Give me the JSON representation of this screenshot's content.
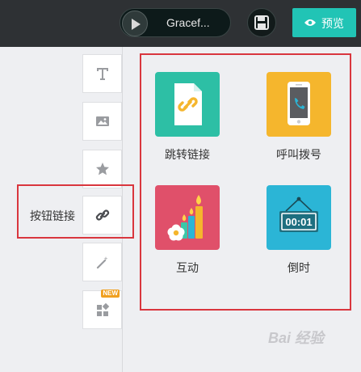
{
  "topbar": {
    "music_title": "Gracef...",
    "preview_label": "预览",
    "colors": {
      "bar": "#2e3134",
      "accent": "#21c4b5"
    }
  },
  "sidebar": {
    "tools": [
      {
        "name": "text",
        "icon": "text-icon"
      },
      {
        "name": "image",
        "icon": "image-icon"
      },
      {
        "name": "shape",
        "icon": "star-icon"
      },
      {
        "name": "button-link",
        "icon": "link-icon",
        "label": "按钮链接"
      },
      {
        "name": "effect",
        "icon": "magic-wand-icon"
      },
      {
        "name": "components",
        "icon": "widgets-icon",
        "badge": "NEW"
      }
    ]
  },
  "features": [
    {
      "label": "跳转链接",
      "icon": "link-file-icon",
      "color": "#2dbfa5"
    },
    {
      "label": "呼叫拨号",
      "icon": "phone-icon",
      "color": "#f5b62d"
    },
    {
      "label": "互动",
      "icon": "candles-icon",
      "color": "#e0506a"
    },
    {
      "label": "倒时",
      "icon": "countdown-icon",
      "color": "#2bb5d6",
      "clock_text": "00:01"
    }
  ],
  "watermark": "Bai 经验"
}
